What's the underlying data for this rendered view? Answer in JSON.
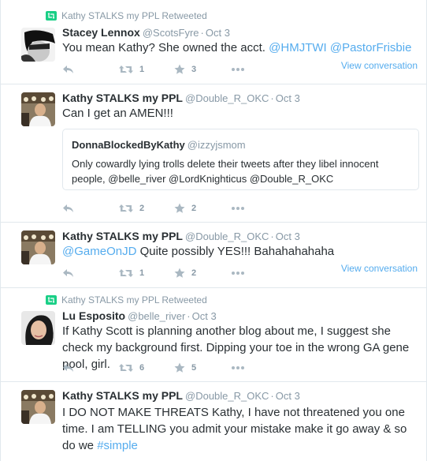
{
  "colors": {
    "link": "#55acee",
    "retweet_green": "#19cf86",
    "muted": "#8899a6",
    "icon": "#aab8c2"
  },
  "tweets": [
    {
      "retweeted_by": "Kathy STALKS my PPL Retweeted",
      "fullname": "Stacey Lennox",
      "handle": "@ScotsFyre",
      "dot": "·",
      "time": "Oct 3",
      "text_plain": "You mean Kathy? She owned the acct. ",
      "mention1": "@HMJTWI",
      "mention2": "@PastorFrisbie",
      "retweets": "1",
      "favorites": "3",
      "view_conversation": "View conversation"
    },
    {
      "fullname": "Kathy STALKS my PPL",
      "handle": "@Double_R_OKC",
      "dot": "·",
      "time": "Oct 3",
      "text": "Can I get an AMEN!!!",
      "quote": {
        "fullname": "DonnaBlockedByKathy",
        "handle": "@izzyjsmom",
        "text": "Only cowardly lying trolls delete their tweets after they libel innocent people, @belle_river @LordKnighticus @Double_R_OKC"
      },
      "retweets": "2",
      "favorites": "2"
    },
    {
      "fullname": "Kathy STALKS my PPL",
      "handle": "@Double_R_OKC",
      "dot": "·",
      "time": "Oct 3",
      "mention": "@GameOnJD",
      "text_plain": " Quite possibly YES!!! Bahahahahaha",
      "retweets": "1",
      "favorites": "2",
      "view_conversation": "View conversation"
    },
    {
      "retweeted_by": "Kathy STALKS my PPL Retweeted",
      "fullname": "Lu Esposito",
      "handle": "@belle_river",
      "dot": "·",
      "time": "Oct 3",
      "text": "If Kathy Scott is planning another blog about me, I suggest she check my background first. Dipping your toe in the wrong GA gene pool, girl.",
      "retweets": "6",
      "favorites": "5"
    },
    {
      "fullname": "Kathy STALKS my PPL",
      "handle": "@Double_R_OKC",
      "dot": "·",
      "time": "Oct 3",
      "text_plain": "I DO NOT MAKE THREATS Kathy, I have not threatened you one time. I am TELLING you admit your mistake make it go away & so do we ",
      "hashtag": "#simple"
    }
  ]
}
